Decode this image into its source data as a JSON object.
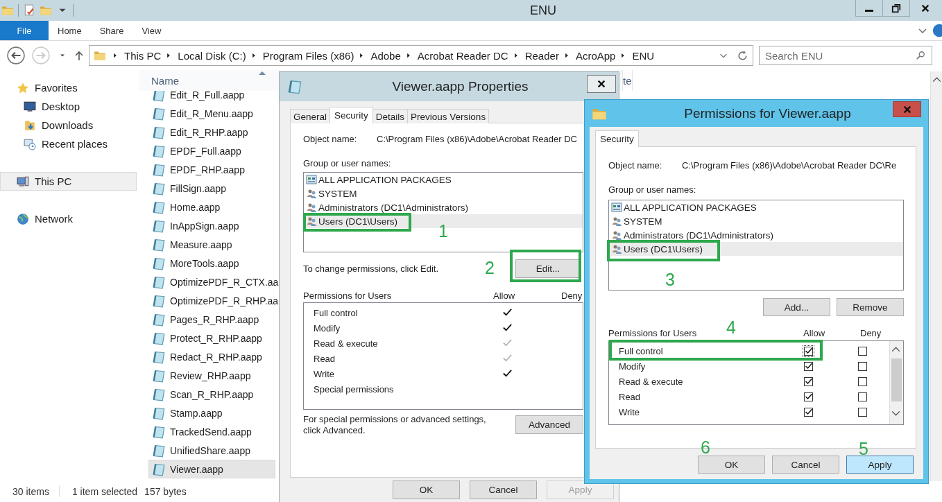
{
  "explorer": {
    "title": "ENU",
    "ribbon_tabs": [
      {
        "label": "File",
        "kind": "file",
        "selected": false
      },
      {
        "label": "Home",
        "kind": "tab",
        "selected": false
      },
      {
        "label": "Share",
        "kind": "tab",
        "selected": false
      },
      {
        "label": "View",
        "kind": "tab",
        "selected": false
      }
    ],
    "breadcrumb": [
      "This PC",
      "Local Disk (C:)",
      "Program Files (x86)",
      "Adobe",
      "Acrobat Reader DC",
      "Reader",
      "AcroApp",
      "ENU"
    ],
    "search": {
      "placeholder": "Search ENU"
    },
    "nav": [
      {
        "label": "Favorites",
        "kind": "star",
        "selected": false
      },
      {
        "label": "Desktop",
        "kind": "desktop",
        "selected": false
      },
      {
        "label": "Downloads",
        "kind": "downloads",
        "selected": false
      },
      {
        "label": "Recent places",
        "kind": "recent",
        "selected": false
      },
      {
        "label": "This PC",
        "kind": "pc",
        "selected": true
      },
      {
        "label": "Network",
        "kind": "network",
        "selected": false
      }
    ],
    "columns": [
      {
        "label": "Name"
      },
      {
        "label": "te"
      }
    ],
    "files": [
      {
        "name": "Edit_R_Full.aapp",
        "selected": false
      },
      {
        "name": "Edit_R_Menu.aapp",
        "selected": false
      },
      {
        "name": "Edit_R_RHP.aapp",
        "selected": false
      },
      {
        "name": "EPDF_Full.aapp",
        "selected": false
      },
      {
        "name": "EPDF_RHP.aapp",
        "selected": false
      },
      {
        "name": "FillSign.aapp",
        "selected": false
      },
      {
        "name": "Home.aapp",
        "selected": false
      },
      {
        "name": "InAppSign.aapp",
        "selected": false
      },
      {
        "name": "Measure.aapp",
        "selected": false
      },
      {
        "name": "MoreTools.aapp",
        "selected": false
      },
      {
        "name": "OptimizePDF_R_CTX.aa",
        "selected": false
      },
      {
        "name": "OptimizePDF_R_RHP.aa",
        "selected": false
      },
      {
        "name": "Pages_R_RHP.aapp",
        "selected": false
      },
      {
        "name": "Protect_R_RHP.aapp",
        "selected": false
      },
      {
        "name": "Redact_R_RHP.aapp",
        "selected": false
      },
      {
        "name": "Review_RHP.aapp",
        "selected": false
      },
      {
        "name": "Scan_R_RHP.aapp",
        "selected": false
      },
      {
        "name": "Stamp.aapp",
        "selected": false
      },
      {
        "name": "TrackedSend.aapp",
        "selected": false
      },
      {
        "name": "UnifiedShare.aapp",
        "selected": false
      },
      {
        "name": "Viewer.aapp",
        "selected": true
      }
    ],
    "status_bar": [
      "30 items",
      "1 item selected",
      "157 bytes"
    ]
  },
  "properties_dialog": {
    "title": "Viewer.aapp Properties",
    "tabs": [
      {
        "label": "General",
        "selected": false
      },
      {
        "label": "Security",
        "selected": true
      },
      {
        "label": "Details",
        "selected": false
      },
      {
        "label": "Previous Versions",
        "selected": false
      }
    ],
    "object_name_label": "Object name:",
    "object_name": "C:\\Program Files (x86)\\Adobe\\Acrobat Reader DC",
    "groups_label": "Group or user names:",
    "groups": [
      {
        "name": "ALL APPLICATION PACKAGES",
        "kind": "packages",
        "selected": false
      },
      {
        "name": "SYSTEM",
        "kind": "users",
        "selected": false
      },
      {
        "name": "Administrators (DC1\\Administrators)",
        "kind": "users",
        "selected": false
      },
      {
        "name": "Users (DC1\\Users)",
        "kind": "users",
        "selected": true
      }
    ],
    "edit_hint": "To change permissions, click Edit.",
    "edit_button": "Edit...",
    "permissions_label": "Permissions for Users",
    "allow_header": "Allow",
    "deny_header": "Deny",
    "permissions": [
      {
        "name": "Full control",
        "allow": true,
        "dimmed": false
      },
      {
        "name": "Modify",
        "allow": true,
        "dimmed": false
      },
      {
        "name": "Read & execute",
        "allow": true,
        "dimmed": true
      },
      {
        "name": "Read",
        "allow": true,
        "dimmed": true
      },
      {
        "name": "Write",
        "allow": true,
        "dimmed": false
      },
      {
        "name": "Special permissions",
        "allow": false
      }
    ],
    "advanced_hint": "For special permissions or advanced settings, click Advanced.",
    "advanced_button": "Advanced",
    "buttons": [
      {
        "label": "OK",
        "disabled": false
      },
      {
        "label": "Cancel",
        "disabled": false
      },
      {
        "label": "Apply",
        "disabled": true
      }
    ]
  },
  "permissions_dialog": {
    "title": "Permissions for Viewer.aapp",
    "tabs": [
      {
        "label": "Security",
        "selected": true
      }
    ],
    "object_name_label": "Object name:",
    "object_name": "C:\\Program Files (x86)\\Adobe\\Acrobat Reader DC\\Re",
    "groups_label": "Group or user names:",
    "groups": [
      {
        "name": "ALL APPLICATION PACKAGES",
        "kind": "packages",
        "selected": false
      },
      {
        "name": "SYSTEM",
        "kind": "users",
        "selected": false
      },
      {
        "name": "Administrators (DC1\\Administrators)",
        "kind": "users",
        "selected": false
      },
      {
        "name": "Users (DC1\\Users)",
        "kind": "users",
        "selected": true
      }
    ],
    "group_buttons": [
      "Add...",
      "Remove"
    ],
    "permissions_label": "Permissions for Users",
    "allow_header": "Allow",
    "deny_header": "Deny",
    "permissions": [
      {
        "name": "Full control",
        "allow": true,
        "deny": false,
        "focused": true
      },
      {
        "name": "Modify",
        "allow": true,
        "deny": false,
        "focused": false
      },
      {
        "name": "Read & execute",
        "allow": true,
        "deny": false,
        "focused": false
      },
      {
        "name": "Read",
        "allow": true,
        "deny": false,
        "focused": false
      },
      {
        "name": "Write",
        "allow": true,
        "deny": false,
        "focused": false
      }
    ],
    "buttons": [
      {
        "label": "OK",
        "highlighted": false
      },
      {
        "label": "Cancel",
        "highlighted": false
      },
      {
        "label": "Apply",
        "highlighted": true
      }
    ]
  },
  "annotations": [
    {
      "kind": "box"
    },
    {
      "kind": "box"
    },
    {
      "kind": "box"
    },
    {
      "kind": "box"
    },
    {
      "kind": "number",
      "text": "1"
    },
    {
      "kind": "number",
      "text": "2"
    },
    {
      "kind": "number",
      "text": "3"
    },
    {
      "kind": "number",
      "text": "4"
    },
    {
      "kind": "number",
      "text": "6"
    },
    {
      "kind": "number",
      "text": "5"
    }
  ]
}
